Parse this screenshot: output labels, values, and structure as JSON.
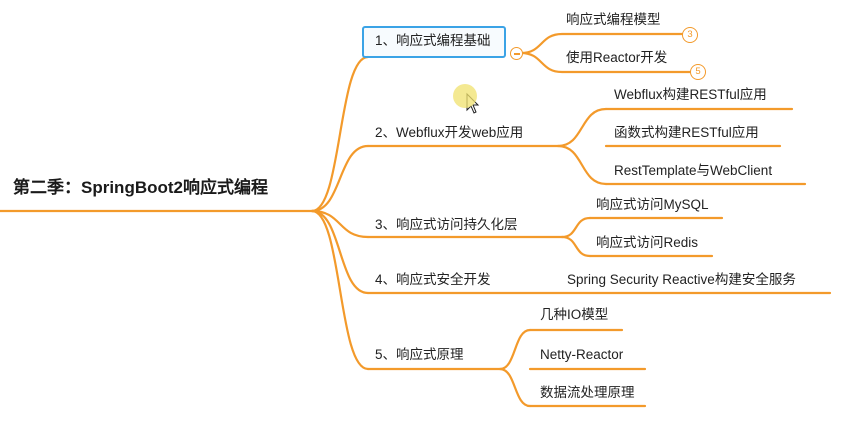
{
  "colors": {
    "branch": "#f39a2b",
    "selection": "#3ba3e6",
    "text": "#222222"
  },
  "root": {
    "label": "第二季：SpringBoot2响应式编程"
  },
  "branches": [
    {
      "label": "1、响应式编程基础",
      "selected": true,
      "children": [
        {
          "label": "响应式编程模型",
          "badge": "3"
        },
        {
          "label": "使用Reactor开发",
          "badge": "5"
        }
      ]
    },
    {
      "label": "2、Webflux开发web应用",
      "children": [
        {
          "label": "Webflux构建RESTful应用"
        },
        {
          "label": "函数式构建RESTful应用"
        },
        {
          "label": "RestTemplate与WebClient"
        }
      ]
    },
    {
      "label": "3、响应式访问持久化层",
      "children": [
        {
          "label": "响应式访问MySQL"
        },
        {
          "label": "响应式访问Redis"
        }
      ]
    },
    {
      "label": "4、响应式安全开发",
      "children": [
        {
          "label": "Spring Security Reactive构建安全服务"
        }
      ]
    },
    {
      "label": "5、响应式原理",
      "children": [
        {
          "label": "几种IO模型"
        },
        {
          "label": "Netty-Reactor"
        },
        {
          "label": "数据流处理原理"
        }
      ]
    }
  ]
}
